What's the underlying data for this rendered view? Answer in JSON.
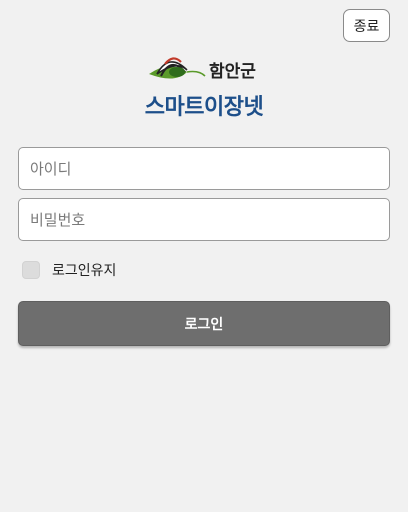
{
  "header": {
    "exit_label": "종료"
  },
  "brand": {
    "logo_text": "함안군",
    "app_title": "스마트이장넷",
    "logo_icon": "county-emblem-icon",
    "title_color": "#1d4f8a"
  },
  "login_form": {
    "id_placeholder": "아이디",
    "id_value": "",
    "password_placeholder": "비밀번호",
    "password_value": "",
    "keep_login_label": "로그인유지",
    "keep_login_checked": false,
    "submit_label": "로그인",
    "submit_color": "#6e6e6e"
  }
}
